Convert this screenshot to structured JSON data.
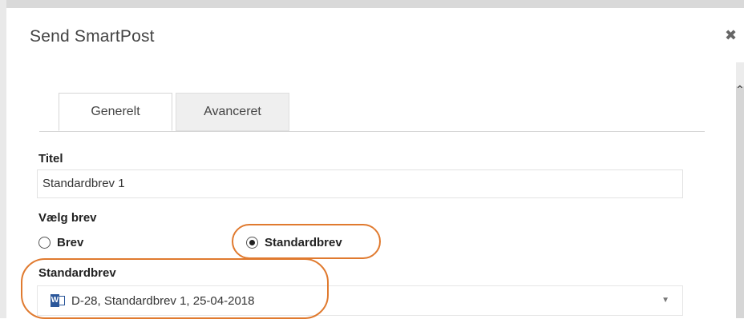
{
  "dialog": {
    "title": "Send SmartPost",
    "close_glyph": "✖"
  },
  "tabs": [
    {
      "label": "Generelt",
      "active": true
    },
    {
      "label": "Avanceret",
      "active": false
    }
  ],
  "fields": {
    "title_label": "Titel",
    "title_value": "Standardbrev 1",
    "choose_label": "Vælg brev",
    "radio_brev": "Brev",
    "radio_standard": "Standardbrev",
    "selected_radio": "Standardbrev",
    "standard_label": "Standardbrev",
    "standard_value": "D-28, Standardbrev 1, 25-04-2018"
  },
  "icons": {
    "close": "close-icon",
    "word": "word-document-icon",
    "dropdown": "chevron-down-icon"
  },
  "colors": {
    "highlight": "#e07a2f",
    "word_blue": "#2b579a"
  }
}
